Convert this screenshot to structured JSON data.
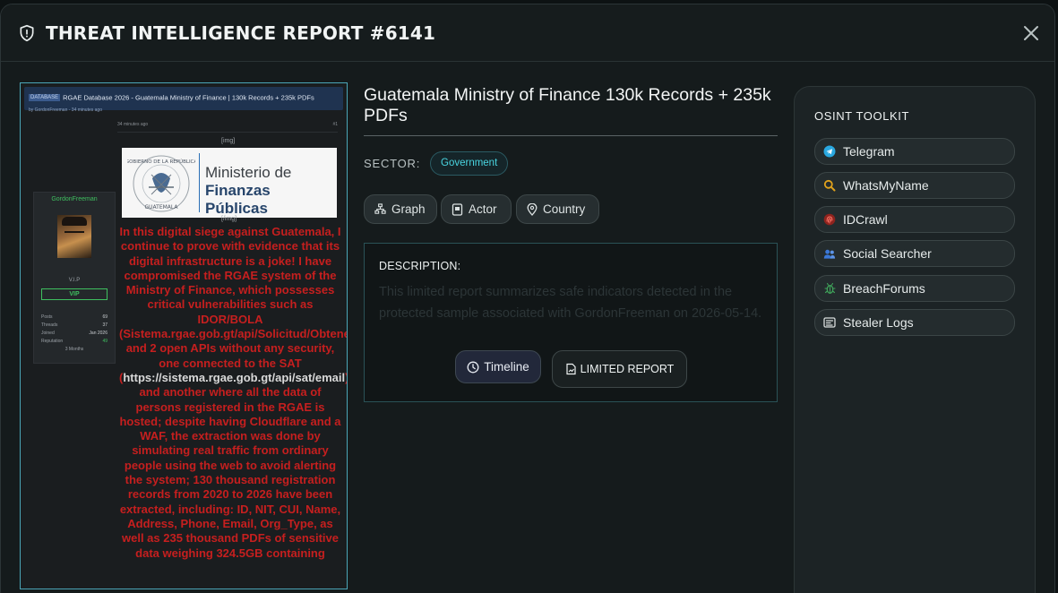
{
  "header": {
    "title": "THREAT INTELLIGENCE REPORT #6141"
  },
  "evidence": {
    "tag": "DATABASE",
    "topic": "RGAE Database 2026 - Guatemala Ministry of Finance | 130k Records + 235k PDFs",
    "byline": "by GordonFreeman - 34 minutes ago",
    "post_time": "34 minutes ago",
    "post_number": "#1",
    "img_tag_open": "[img]",
    "img_tag_close": "[/img]",
    "logo_line1": "Ministerio de",
    "logo_line2": "Finanzas Públicas",
    "user": {
      "name": "GordonFreeman",
      "rank": "V.I.P",
      "badge": "VIP",
      "stats": [
        {
          "label": "Posts",
          "value": "69"
        },
        {
          "label": "Threads",
          "value": "37"
        },
        {
          "label": "Joined",
          "value": "Jan 2026"
        },
        {
          "label": "Reputation",
          "value": "49"
        }
      ],
      "months": "3 Months"
    },
    "post_text_1": "In this digital siege against Guatemala, I continue to prove with evidence that its digital infrastructure is a joke! I have compromised the RGAE system of the Ministry of Finance, which possesses critical vulnerabilities such as IDOR/BOLA (Sistema.rgae.gob.gt/api/Solicitud/ObtenerSecciones) and 2 open APIs without any security, one connected to the SAT (",
    "post_url": "https://sistema.rgae.gob.gt/api/sat/email",
    "post_text_2": ") and another where all the data of persons registered in the RGAE is hosted; despite having Cloudflare and a WAF, the extraction was done by simulating real traffic from ordinary people using the web to avoid alerting the system; 130 thousand registration records from 2020 to 2026 have been extracted, including: ID, NIT, CUI, Name, Address, Phone, Email, Org_Type, as well as 235 thousand PDFs of sensitive data weighing 324.5GB containing"
  },
  "report": {
    "title": "Guatemala Ministry of Finance 130k Records + 235k PDFs",
    "sector_label": "SECTOR:",
    "sector_value": "Government",
    "pills": {
      "graph": "Graph",
      "actor": "Actor",
      "country": "Country"
    },
    "description_label": "DESCRIPTION:",
    "description_text": "This limited report summarizes safe indicators detected in the protected sample associated with GordonFreeman on 2026-05-14.",
    "timeline_label": "Timeline",
    "limited_label": "LIMITED REPORT"
  },
  "toolkit": {
    "title": "OSINT TOOLKIT",
    "tools": [
      {
        "label": "Telegram",
        "icon": "telegram-icon",
        "color": "#2aa8e0"
      },
      {
        "label": "WhatsMyName",
        "icon": "search-icon",
        "color": "#e0a21c"
      },
      {
        "label": "IDCrawl",
        "icon": "fingerprint-icon",
        "color": "#d0372f"
      },
      {
        "label": "Social Searcher",
        "icon": "users-icon",
        "color": "#3b78d8"
      },
      {
        "label": "BreachForums",
        "icon": "bug-icon",
        "color": "#3fa35a"
      },
      {
        "label": "Stealer Logs",
        "icon": "terminal-icon",
        "color": "#d9dede"
      }
    ]
  }
}
